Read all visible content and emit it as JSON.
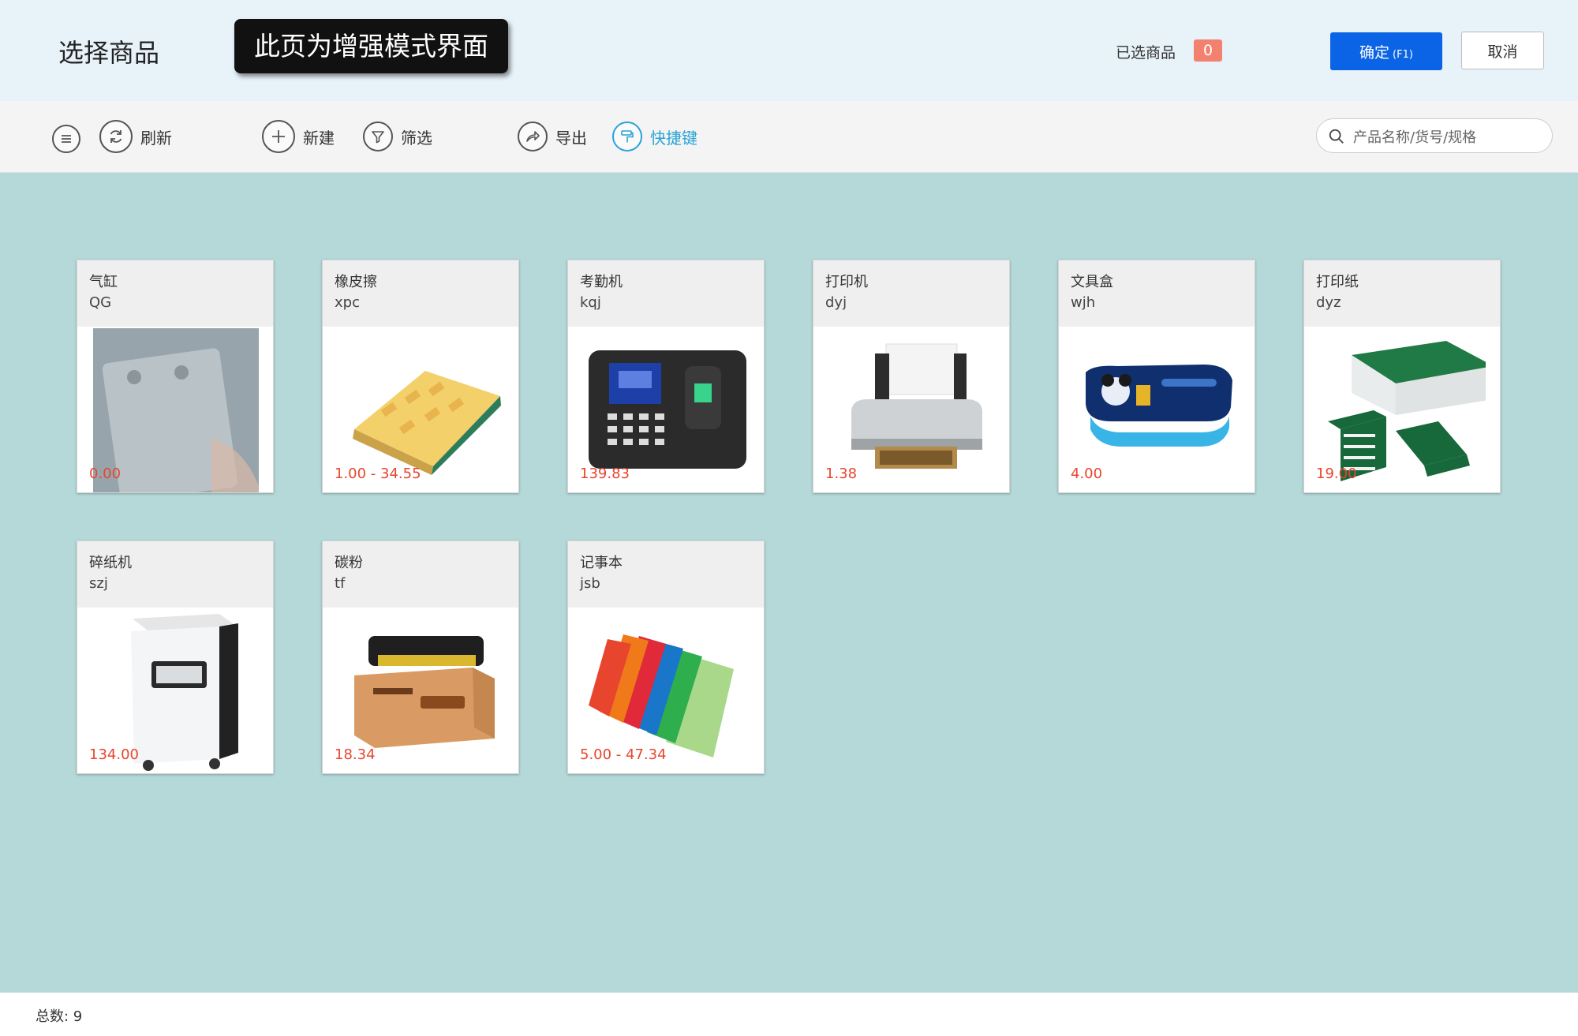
{
  "header": {
    "title": "选择商品",
    "mode_banner": "此页为增强模式界面",
    "selected_label": "已选商品",
    "selected_count": "0",
    "confirm_label": "确定",
    "confirm_shortcut": "(F1)",
    "cancel_label": "取消"
  },
  "toolbar": {
    "refresh": "刷新",
    "new": "新建",
    "filter": "筛选",
    "export": "导出",
    "shortcuts": "快捷键",
    "search_placeholder": "产品名称/货号/规格"
  },
  "products": [
    {
      "name": "气缸",
      "code": "QG",
      "price": "0.00",
      "image": "cylinder-image"
    },
    {
      "name": "橡皮擦",
      "code": "xpc",
      "price": "1.00 - 34.55",
      "image": "eraser-image"
    },
    {
      "name": "考勤机",
      "code": "kqj",
      "price": "139.83",
      "image": "attendance-machine-image"
    },
    {
      "name": "打印机",
      "code": "dyj",
      "price": "1.38",
      "image": "printer-image"
    },
    {
      "name": "文具盒",
      "code": "wjh",
      "price": "4.00",
      "image": "pencil-case-image"
    },
    {
      "name": "打印纸",
      "code": "dyz",
      "price": "19.00",
      "image": "printer-paper-image"
    },
    {
      "name": "碎纸机",
      "code": "szj",
      "price": "134.00",
      "image": "shredder-image"
    },
    {
      "name": "碳粉",
      "code": "tf",
      "price": "18.34",
      "image": "toner-image"
    },
    {
      "name": "记事本",
      "code": "jsb",
      "price": "5.00 - 47.34",
      "image": "notebook-image"
    }
  ],
  "footer": {
    "total_label": "总数: 9"
  },
  "colors": {
    "accent": "#0b63e5",
    "active_tool": "#2aa3d6",
    "price": "#e8452e",
    "badge": "#f2826f",
    "background": "#b5d9d9"
  }
}
